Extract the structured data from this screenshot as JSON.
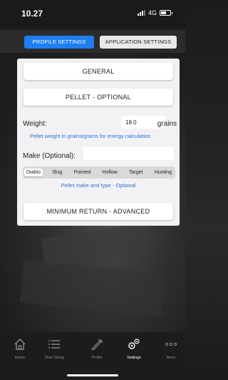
{
  "status": {
    "time": "10.27",
    "network": "4G"
  },
  "top_tabs": [
    {
      "label": "PROFILE SETTINGS",
      "active": true
    },
    {
      "label": "APPLICATION SETTINGS",
      "active": false
    }
  ],
  "panel": {
    "general_label": "GENERAL",
    "pellet_label": "PELLET - OPTIONAL",
    "weight_label": "Weight:",
    "weight_value": "18.0",
    "weight_unit": "grains",
    "weight_help": "Pellet weight in grains/grams for energy calculation",
    "make_label": "Make (Optional):",
    "make_value": "",
    "pellet_types": [
      "Diablo",
      "Slug",
      "Pointed",
      "Hollow",
      "Target",
      "Hunting"
    ],
    "pellet_type_selected": "Diablo",
    "make_help": "Pellet make and type - Optional",
    "min_return_label": "MINIMUM RETURN - ADVANCED"
  },
  "bottom_tabs": [
    {
      "label": "Home",
      "icon": "home-icon",
      "active": false
    },
    {
      "label": "Shot String",
      "icon": "list-icon",
      "active": false
    },
    {
      "label": "Profile",
      "icon": "rifle-icon",
      "active": false
    },
    {
      "label": "Settings",
      "icon": "gears-icon",
      "active": true
    },
    {
      "label": "More",
      "icon": "more-icon",
      "active": false
    }
  ],
  "colors": {
    "accent": "#1e7ff0",
    "help_text": "#2c6fd6"
  }
}
